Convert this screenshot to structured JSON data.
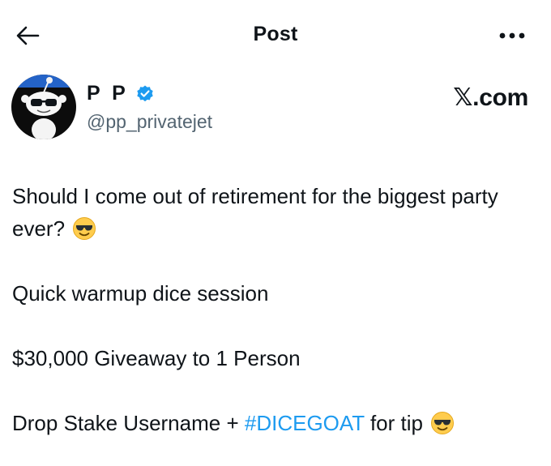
{
  "header": {
    "title": "Post",
    "back_icon": "arrow-left-icon",
    "more_icon": "more-horizontal-icon"
  },
  "author": {
    "display_name": "P P",
    "handle": "@pp_privatejet",
    "verified": true,
    "verified_color": "#1d9bf0"
  },
  "brand": "𝕏.com",
  "post": {
    "line1": "Should I come out of retirement for the biggest party ever?",
    "line2": "Quick warmup dice session",
    "line3": "$30,000 Giveaway to 1 Person",
    "line4_before": "Drop Stake Username + ",
    "line4_hashtag": "#DICEGOAT",
    "line4_after": " for tip",
    "emoji_icon": "smiling-face-with-sunglasses-icon"
  },
  "colors": {
    "text": "#0f1419",
    "secondary": "#536471",
    "link": "#1d9bf0"
  }
}
